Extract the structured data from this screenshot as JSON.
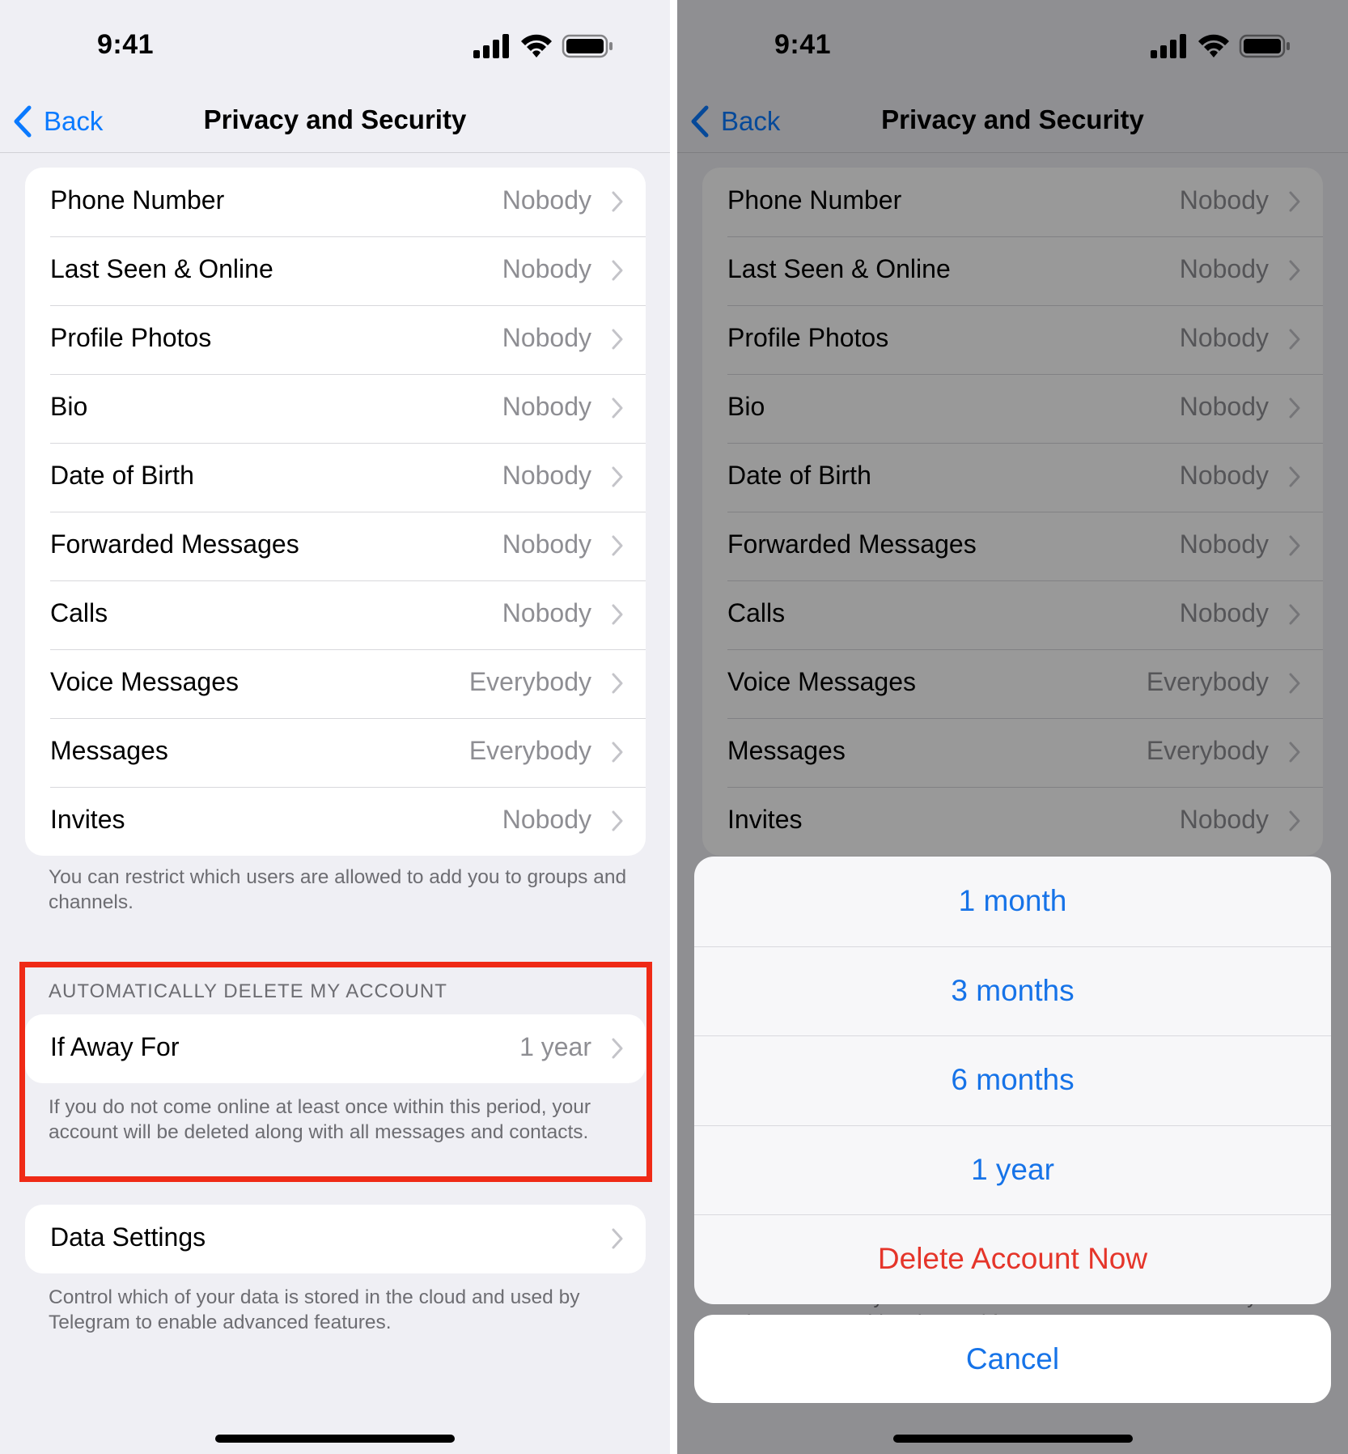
{
  "status_bar": {
    "time": "9:41"
  },
  "nav": {
    "back_label": "Back",
    "title": "Privacy and Security"
  },
  "privacy_rows": [
    {
      "label": "Phone Number",
      "value": "Nobody"
    },
    {
      "label": "Last Seen & Online",
      "value": "Nobody"
    },
    {
      "label": "Profile Photos",
      "value": "Nobody"
    },
    {
      "label": "Bio",
      "value": "Nobody"
    },
    {
      "label": "Date of Birth",
      "value": "Nobody"
    },
    {
      "label": "Forwarded Messages",
      "value": "Nobody"
    },
    {
      "label": "Calls",
      "value": "Nobody"
    },
    {
      "label": "Voice Messages",
      "value": "Everybody"
    },
    {
      "label": "Messages",
      "value": "Everybody"
    },
    {
      "label": "Invites",
      "value": "Nobody"
    }
  ],
  "invites_footnote": "You can restrict which users are allowed to add you to groups and channels.",
  "auto_delete": {
    "header": "AUTOMATICALLY DELETE MY ACCOUNT",
    "row_label": "If Away For",
    "row_value": "1 year",
    "footnote": "If you do not come online at least once within this period, your account will be deleted along with all messages and contacts."
  },
  "data_settings": {
    "label": "Data Settings",
    "footnote": "Control which of your data is stored in the cloud and used by Telegram to enable advanced features."
  },
  "action_sheet": {
    "options": [
      "1 month",
      "3 months",
      "6 months",
      "1 year"
    ],
    "destructive": "Delete Account Now",
    "cancel": "Cancel"
  },
  "colors": {
    "accent": "#0a7aff",
    "sheet_text": "#1673e8",
    "destructive": "#e5352a",
    "highlight": "#ef2a16",
    "secondary_text": "#8e8e93"
  },
  "icons": {
    "back": "chevron-left-icon",
    "disclosure": "chevron-right-icon",
    "signal": "cellular-signal-icon",
    "wifi": "wifi-icon",
    "battery": "battery-icon"
  }
}
